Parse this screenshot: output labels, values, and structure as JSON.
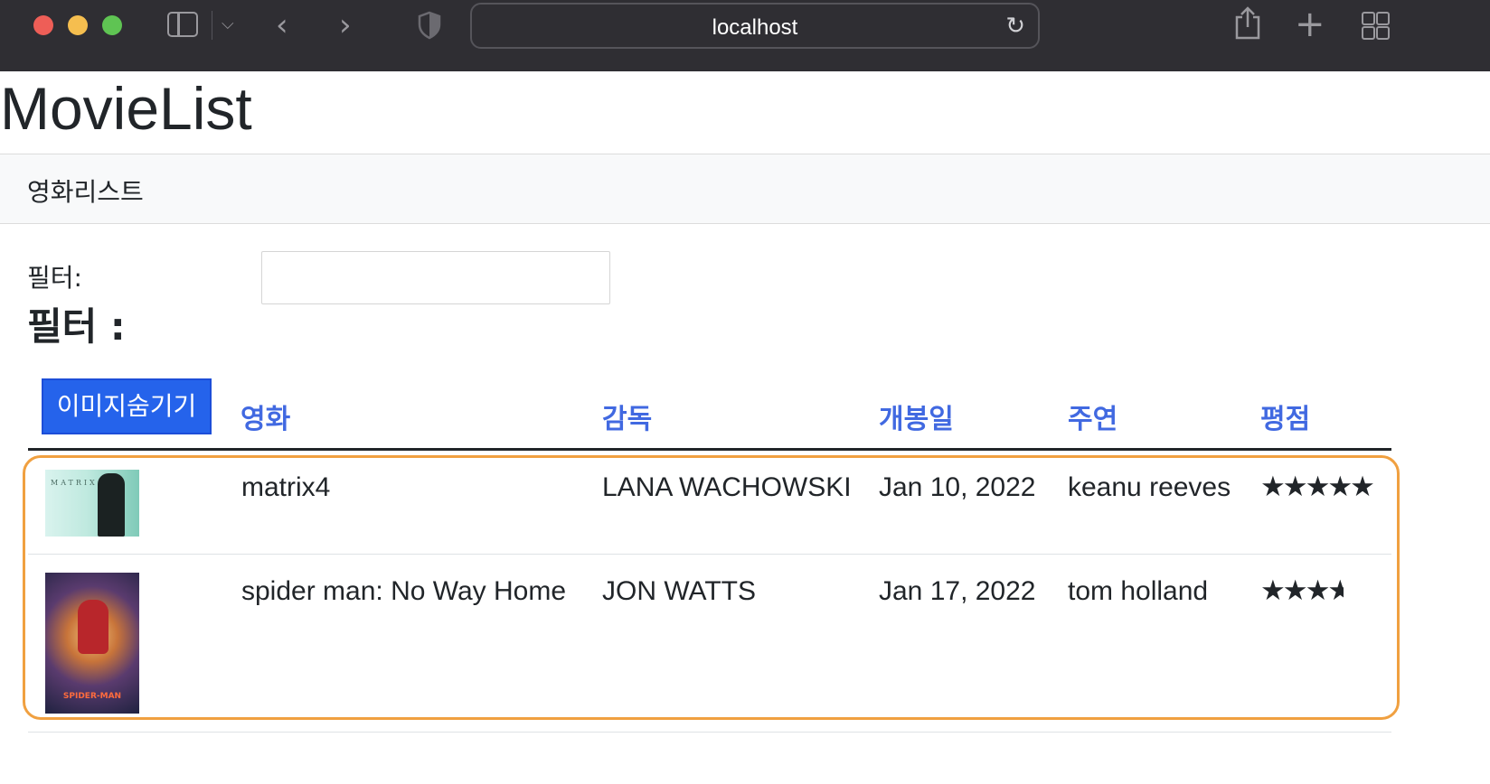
{
  "browser": {
    "url": "localhost",
    "icons": [
      "sidebar-icon",
      "chevron-down-icon",
      "back-icon",
      "forward-icon",
      "shield-icon",
      "reload-icon",
      "share-icon",
      "plus-icon",
      "tab-grid-icon"
    ]
  },
  "app": {
    "title": "MovieList"
  },
  "nav": {
    "link_label": "영화리스트"
  },
  "filter": {
    "label": "필터:",
    "value": "",
    "heading": "필터 :"
  },
  "table": {
    "hide_images_button": "이미지숨기기",
    "headers": [
      "영화",
      "감독",
      "개봉일",
      "주연",
      "평점"
    ],
    "rows": [
      {
        "poster": "matrix-poster",
        "movie": "matrix4",
        "director": "LANA WACHOWSKI",
        "release": "Jan 10, 2022",
        "actor": "keanu reeves",
        "rating": 4.5
      },
      {
        "poster": "spiderman-poster",
        "movie": "spider man: No Way Home",
        "director": "JON WATTS",
        "release": "Jan 17, 2022",
        "actor": "tom holland",
        "rating": 3.3
      }
    ]
  },
  "colors": {
    "header_link": "#4169e1",
    "button_bg": "#2563eb",
    "highlight_border": "#f0a040"
  }
}
